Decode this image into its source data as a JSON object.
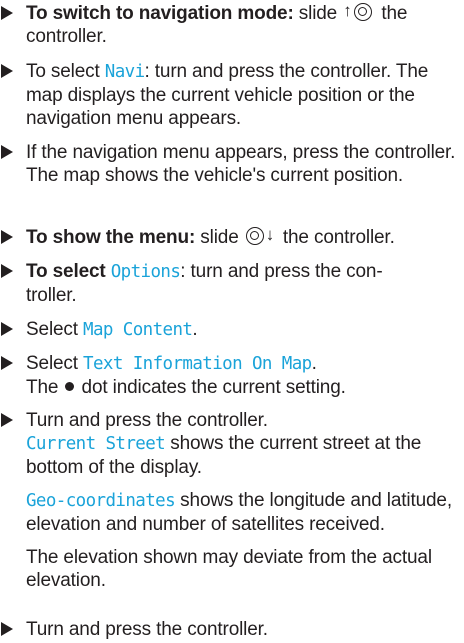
{
  "steps": [
    {
      "bold": "To switch to navigation mode:",
      "t1": " slide ",
      "icon": "controller-slide-up-icon",
      "t2": " the controller."
    },
    {
      "t1": "To select ",
      "ui": "Navi",
      "t2": ": turn and press the controller. The map displays the current vehicle position or the navigation menu appears."
    },
    {
      "t1": "If the navigation menu appears, press the controller.",
      "sub": "The map shows the vehicle's current position."
    },
    {
      "bold": "To show the menu:",
      "t1": " slide ",
      "icon": "controller-slide-down-icon",
      "t2": " the controller."
    },
    {
      "bold": "To select ",
      "ui": "Options",
      "t1a": ": turn and press the con-",
      "t1b": "troller."
    },
    {
      "t1": "Select ",
      "ui": "Map Content",
      "t2": "."
    },
    {
      "t1": "Select ",
      "ui": "Text Information On Map",
      "t2": ".",
      "sub_a": "The ",
      "sub_icon": "dot-icon",
      "sub_b": " dot indicates the current setting."
    },
    {
      "t1": "Turn and press the controller.",
      "p1_ui": "Current Street",
      "p1_text": " shows the current street at the bottom of the display.",
      "p2_ui": "Geo-coordinates",
      "p2_text": " shows the longitude and latitude, elevation and number of satellites received.",
      "p3_text": "The elevation shown may deviate from the actual elevation."
    },
    {
      "t1": "Turn and press the controller."
    }
  ],
  "colors": {
    "text": "#231f20",
    "ui_highlight": "#1aa3d9"
  }
}
